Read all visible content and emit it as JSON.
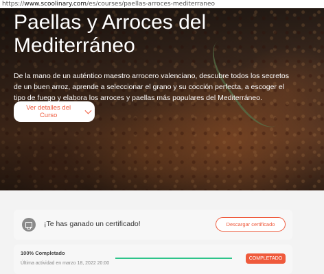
{
  "browser": {
    "url_prefix": "https://",
    "url_domain": "www.scoolinary.com",
    "url_path": "/es/courses/paellas-arroces-mediterraneo"
  },
  "hero": {
    "title": "Paellas y Arroces del Mediterráneo",
    "description": "De la mano de un auténtico maestro arrocero valenciano, descubre todos los secretos de un buen arroz, aprende a seleccionar el grano y su cocción perfecta, a escoger el tipo de fuego y elabora los arroces y paellas más populares del Mediterráneo.",
    "details_button": "Ver detalles del Curso"
  },
  "certificate": {
    "message": "¡Te has ganado un certificado!",
    "download_button": "Descargar certificado",
    "icon": "certificate-icon"
  },
  "progress": {
    "title": "100% Completado",
    "last_activity": "Última actividad en marzo 18, 2022 20:00",
    "percent": 100,
    "status_badge": "COMPLETADO"
  },
  "colors": {
    "accent": "#ef5a3c",
    "progress": "#2ec48a"
  }
}
